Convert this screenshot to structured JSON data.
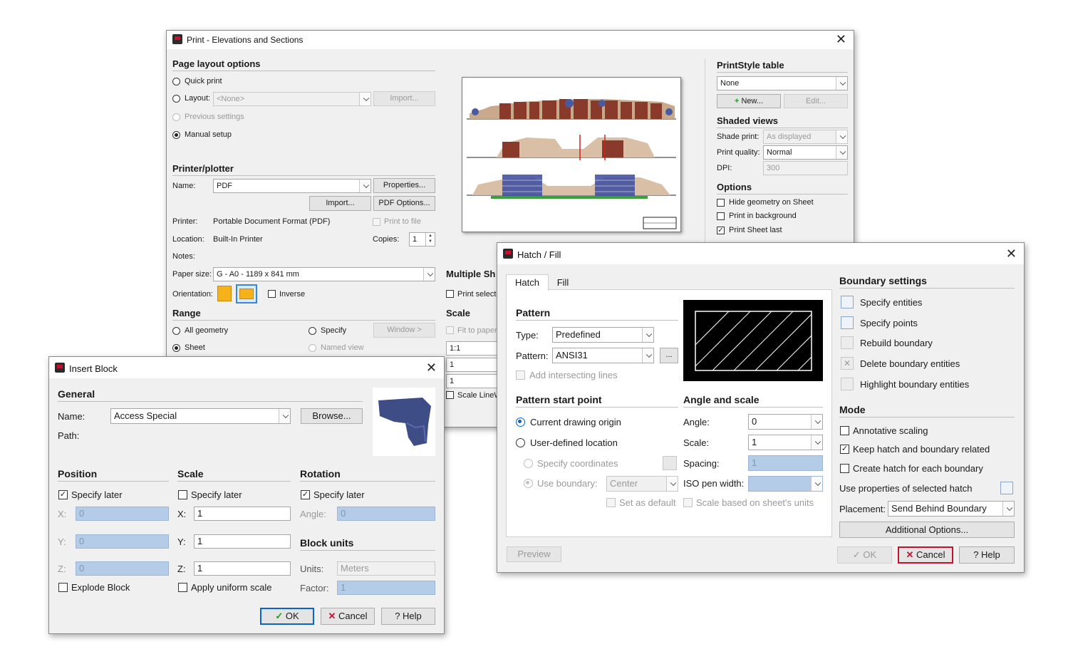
{
  "print": {
    "title": "Print - Elevations and Sections",
    "page_layout": {
      "header": "Page layout options",
      "quick_print": "Quick print",
      "layout": "Layout:",
      "layout_value": "<None>",
      "import": "Import...",
      "previous_settings": "Previous settings",
      "manual_setup": "Manual setup"
    },
    "printer": {
      "header": "Printer/plotter",
      "name_label": "Name:",
      "name_value": "PDF",
      "properties": "Properties...",
      "import": "Import...",
      "pdf_options": "PDF Options...",
      "printer_label": "Printer:",
      "printer_value": "Portable Document Format (PDF)",
      "print_to_file": "Print to file",
      "location_label": "Location:",
      "location_value": "Built-In Printer",
      "copies_label": "Copies:",
      "copies_value": "1",
      "notes_label": "Notes:",
      "paper_size_label": "Paper size:",
      "paper_size_value": "G - A0 - 1189 x 841 mm",
      "orientation_label": "Orientation:",
      "inverse": "Inverse"
    },
    "range": {
      "header": "Range",
      "all_geometry": "All geometry",
      "specify": "Specify",
      "window": "Window >",
      "sheet": "Sheet",
      "named_view": "Named view"
    },
    "multiple_sheets": {
      "header": "Multiple Sh",
      "print_selected": "Print selecte"
    },
    "scale": {
      "header": "Scale",
      "fit_to_paper": "Fit to paper",
      "ratio": "1:1",
      "v1": "1",
      "v2": "1",
      "scale_lineweights": "Scale LineW"
    },
    "printstyle": {
      "header": "PrintStyle table",
      "value": "None",
      "new": "New...",
      "edit": "Edit..."
    },
    "shaded": {
      "header": "Shaded views",
      "shade_print_label": "Shade print:",
      "shade_print_value": "As displayed",
      "print_quality_label": "Print quality:",
      "print_quality_value": "Normal",
      "dpi_label": "DPI:",
      "dpi_value": "300"
    },
    "options": {
      "header": "Options",
      "hide_geometry": "Hide geometry on Sheet",
      "print_background": "Print in background",
      "print_sheet_last": "Print Sheet last"
    }
  },
  "insert": {
    "title": "Insert Block",
    "general": "General",
    "name_label": "Name:",
    "name_value": "Access Special",
    "browse": "Browse...",
    "path_label": "Path:",
    "position": {
      "header": "Position",
      "specify_later": "Specify later",
      "x": "X:",
      "y": "Y:",
      "z": "Z:",
      "xv": "0",
      "yv": "0",
      "zv": "0",
      "explode": "Explode Block"
    },
    "scale": {
      "header": "Scale",
      "specify_later": "Specify later",
      "x": "X:",
      "y": "Y:",
      "z": "Z:",
      "xv": "1",
      "yv": "1",
      "zv": "1",
      "uniform": "Apply uniform scale"
    },
    "rotation": {
      "header": "Rotation",
      "specify_later": "Specify later",
      "angle_label": "Angle:",
      "angle_value": "0"
    },
    "units": {
      "header": "Block units",
      "units_label": "Units:",
      "units_value": "Meters",
      "factor_label": "Factor:",
      "factor_value": "1"
    },
    "ok": "OK",
    "cancel": "Cancel",
    "help": "Help"
  },
  "hatch": {
    "title": "Hatch / Fill",
    "tab_hatch": "Hatch",
    "tab_fill": "Fill",
    "pattern": {
      "header": "Pattern",
      "type_label": "Type:",
      "type_value": "Predefined",
      "pattern_label": "Pattern:",
      "pattern_value": "ANSI31",
      "more": "...",
      "add_intersecting": "Add intersecting lines"
    },
    "start": {
      "header": "Pattern start point",
      "current_origin": "Current drawing origin",
      "user_defined": "User-defined location",
      "specify_coords": "Specify coordinates",
      "use_boundary": "Use boundary:",
      "boundary_value": "Center",
      "set_default": "Set as default"
    },
    "angle_scale": {
      "header": "Angle and scale",
      "angle_label": "Angle:",
      "angle_value": "0",
      "scale_label": "Scale:",
      "scale_value": "1",
      "spacing_label": "Spacing:",
      "spacing_value": "1",
      "iso_label": "ISO pen width:",
      "scale_sheet_units": "Scale based on sheet's units"
    },
    "boundary": {
      "header": "Boundary settings",
      "specify_entities": "Specify entities",
      "specify_points": "Specify points",
      "rebuild": "Rebuild boundary",
      "delete": "Delete boundary entities",
      "highlight": "Highlight boundary entities"
    },
    "mode": {
      "header": "Mode",
      "annotative": "Annotative scaling",
      "keep_related": "Keep hatch and boundary related",
      "each_boundary": "Create hatch for each boundary",
      "use_properties": "Use properties of selected hatch",
      "placement_label": "Placement:",
      "placement_value": "Send Behind Boundary",
      "additional": "Additional Options..."
    },
    "preview": "Preview",
    "ok": "OK",
    "cancel": "Cancel",
    "help": "Help"
  }
}
